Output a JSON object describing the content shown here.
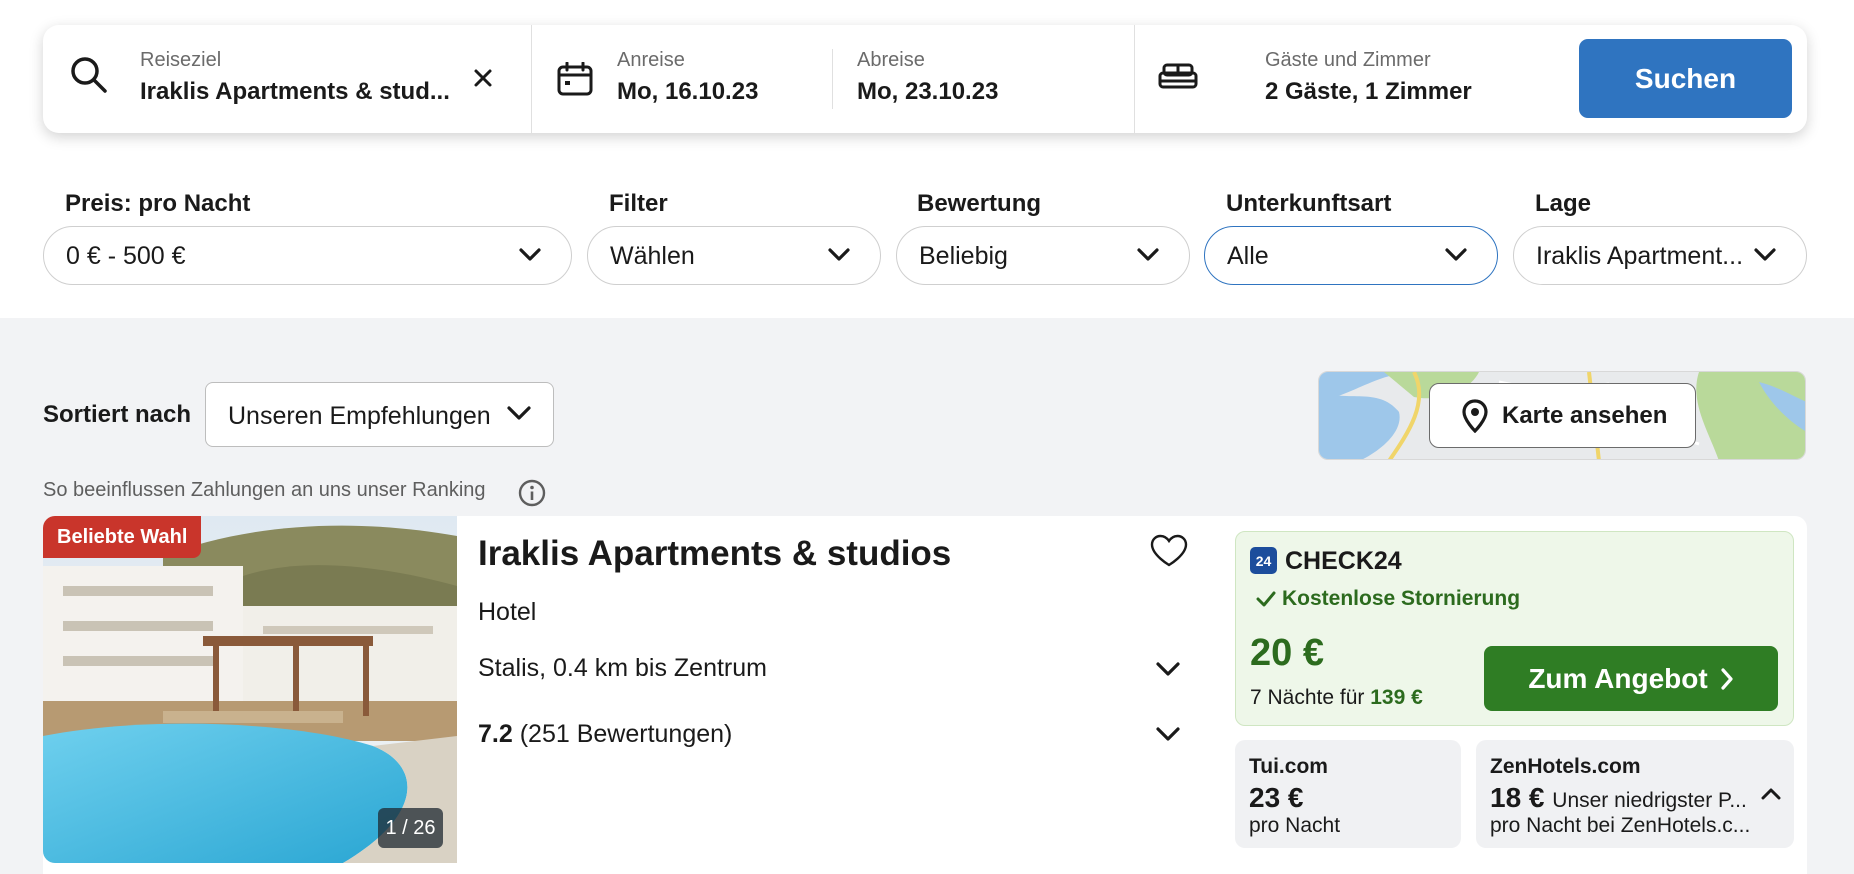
{
  "search": {
    "destination_label": "Reiseziel",
    "destination_value": "Iraklis Apartments & stud...",
    "checkin_label": "Anreise",
    "checkin_value": "Mo, 16.10.23",
    "checkout_label": "Abreise",
    "checkout_value": "Mo, 23.10.23",
    "guests_label": "Gäste und Zimmer",
    "guests_value": "2 Gäste, 1 Zimmer",
    "search_button": "Suchen"
  },
  "filters": [
    {
      "label": "Preis: pro Nacht",
      "value": "0 € - 500 €"
    },
    {
      "label": "Filter",
      "value": "Wählen"
    },
    {
      "label": "Bewertung",
      "value": "Beliebig"
    },
    {
      "label": "Unterkunftsart",
      "value": "Alle"
    },
    {
      "label": "Lage",
      "value": "Iraklis Apartment..."
    }
  ],
  "sort": {
    "label": "Sortiert nach",
    "value": "Unseren Empfehlungen"
  },
  "map": {
    "button": "Karte ansehen"
  },
  "ranking_note": "So beeinflussen Zahlungen an uns unser Ranking",
  "hotel": {
    "badge": "Beliebte Wahl",
    "image_counter": "1 / 26",
    "name": "Iraklis Apartments & studios",
    "type": "Hotel",
    "location": "Stalis, 0.4 km bis Zentrum",
    "rating_score": "7.2",
    "rating_count": "(251 Bewertungen)"
  },
  "offer": {
    "provider_logo": "24",
    "provider": "CHECK24",
    "cancellation": "Kostenlose Stornierung",
    "price": "20 €",
    "nights_text": "7 Nächte für",
    "nights_total": "139 €",
    "button": "Zum Angebot"
  },
  "other_offers": [
    {
      "provider": "Tui.com",
      "price": "23 €",
      "note": "",
      "sub": "pro Nacht"
    },
    {
      "provider": "ZenHotels.com",
      "price": "18 €",
      "note": "Unser niedrigster P...",
      "sub": "pro Nacht bei ZenHotels.c..."
    }
  ],
  "colors": {
    "primary_blue": "#2f74c0",
    "green": "#2f7d24",
    "badge_red": "#c9352b"
  }
}
